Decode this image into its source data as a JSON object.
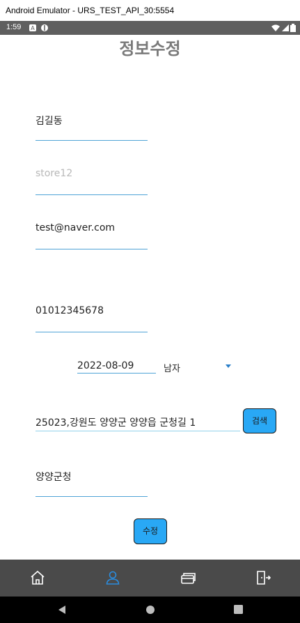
{
  "window": {
    "title": "Android Emulator - URS_TEST_API_30:5554"
  },
  "status_bar": {
    "time": "1:59"
  },
  "page": {
    "title": "정보수정"
  },
  "form": {
    "name_value": "김길동",
    "store_placeholder": "store12",
    "email_value": "test@naver.com",
    "phone_value": "01012345678",
    "birthdate_value": "2022-08-09",
    "gender_value": "남자",
    "address_value": "25023,강원도 양양군 양양읍 군청길 1",
    "detail_address_value": "양양군청"
  },
  "buttons": {
    "search_label": "검색",
    "edit_label": "수정"
  },
  "colors": {
    "accent": "#29a8f5",
    "underline": "#4fa3d6",
    "nav_active": "#2a8de0",
    "nav_bg": "#4a4a4a"
  },
  "nav": [
    "home-icon",
    "person-icon",
    "card-icon",
    "logout-icon"
  ]
}
